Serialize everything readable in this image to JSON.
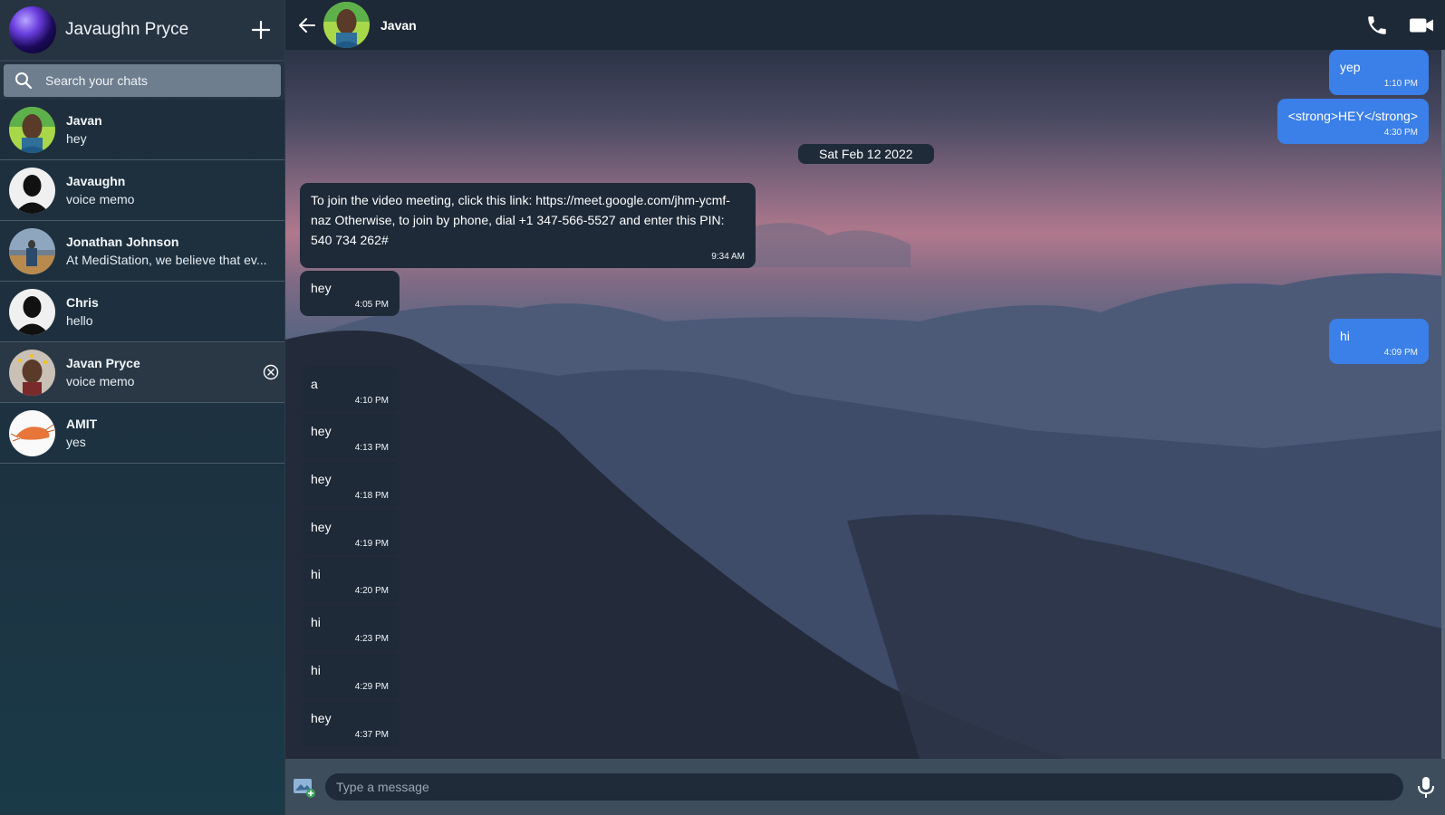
{
  "sidebar": {
    "user_name": "Javaughn Pryce",
    "search_placeholder": "Search your chats",
    "chats": [
      {
        "name": "Javan",
        "preview": "hey",
        "avatar": "person-photo"
      },
      {
        "name": "Javaughn",
        "preview": "voice memo",
        "avatar": "default-silhouette"
      },
      {
        "name": "Jonathan Johnson",
        "preview": "At MediStation, we believe that ev...",
        "avatar": "field-photo"
      },
      {
        "name": "Chris",
        "preview": "hello",
        "avatar": "default-silhouette"
      },
      {
        "name": "Javan Pryce",
        "preview": "voice memo",
        "avatar": "person-photo"
      },
      {
        "name": "AMIT",
        "preview": "yes",
        "avatar": "shrimp-photo"
      }
    ]
  },
  "header": {
    "contact_name": "Javan"
  },
  "conversation": {
    "date_divider": "Sat Feb 12 2022",
    "messages": [
      {
        "dir": "out",
        "text": "yep",
        "time": "1:10 PM"
      },
      {
        "dir": "out",
        "text": "<strong>HEY</strong>",
        "time": "4:30 PM"
      },
      {
        "dir": "in",
        "text": "To join the video meeting, click this link: https://meet.google.com/jhm-ycmf-naz Otherwise, to join by phone, dial +1 347-566-5527 and enter this PIN: 540 734 262#",
        "time": "9:34 AM"
      },
      {
        "dir": "in",
        "text": "hey",
        "time": "4:05 PM"
      },
      {
        "dir": "out",
        "text": "hi",
        "time": "4:09 PM"
      },
      {
        "dir": "in",
        "text": "a",
        "time": "4:10 PM"
      },
      {
        "dir": "in",
        "text": "hey",
        "time": "4:13 PM"
      },
      {
        "dir": "in",
        "text": "hey",
        "time": "4:18 PM"
      },
      {
        "dir": "in",
        "text": "hey",
        "time": "4:19 PM"
      },
      {
        "dir": "in",
        "text": "hi",
        "time": "4:20 PM"
      },
      {
        "dir": "in",
        "text": "hi",
        "time": "4:23 PM"
      },
      {
        "dir": "in",
        "text": "hi",
        "time": "4:29 PM"
      },
      {
        "dir": "in",
        "text": "hey",
        "time": "4:37 PM"
      }
    ]
  },
  "composer": {
    "placeholder": "Type a message"
  },
  "colors": {
    "outgoing_bubble": "#3b7fe8",
    "incoming_bubble": "#1e2a38",
    "sidebar_bg": "#1f2d3b"
  },
  "icons": [
    "plus-icon",
    "search-icon",
    "back-arrow-icon",
    "phone-icon",
    "video-camera-icon",
    "close-circle-icon",
    "image-attach-icon",
    "microphone-icon"
  ]
}
